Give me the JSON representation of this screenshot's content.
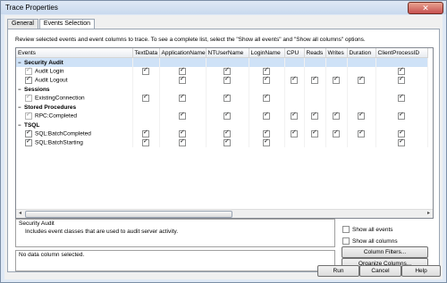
{
  "window": {
    "title": "Trace Properties",
    "close_glyph": "✕"
  },
  "tabs": [
    {
      "label": "General"
    },
    {
      "label": "Events Selection"
    }
  ],
  "description": "Review selected events and event columns to trace. To see a complete list, select the \"Show all events\" and \"Show all columns\" options.",
  "grid": {
    "columns": [
      "Events",
      "TextData",
      "ApplicationName",
      "NTUserName",
      "LoginName",
      "CPU",
      "Reads",
      "Writes",
      "Duration",
      "ClientProcessID"
    ],
    "rows": [
      {
        "type": "category",
        "label": "Security Audit",
        "expander": "−",
        "selected": true
      },
      {
        "type": "event",
        "label": "Audit Login",
        "checked": true,
        "disabled": true,
        "cells": [
          true,
          true,
          true,
          true,
          false,
          false,
          false,
          false,
          true
        ]
      },
      {
        "type": "event",
        "label": "Audit Logout",
        "checked": true,
        "disabled": false,
        "cells": [
          false,
          true,
          true,
          true,
          true,
          true,
          true,
          true,
          true
        ]
      },
      {
        "type": "category",
        "label": "Sessions",
        "expander": "−",
        "selected": false
      },
      {
        "type": "event",
        "label": "ExistingConnection",
        "checked": true,
        "disabled": true,
        "cells": [
          true,
          true,
          true,
          true,
          false,
          false,
          false,
          false,
          true
        ]
      },
      {
        "type": "category",
        "label": "Stored Procedures",
        "expander": "−",
        "selected": false
      },
      {
        "type": "event",
        "label": "RPC:Completed",
        "checked": true,
        "disabled": true,
        "cells": [
          false,
          true,
          true,
          true,
          true,
          true,
          true,
          true,
          true
        ]
      },
      {
        "type": "category",
        "label": "TSQL",
        "expander": "−",
        "selected": false
      },
      {
        "type": "event",
        "label": "SQL:BatchCompleted",
        "checked": true,
        "disabled": false,
        "cells": [
          true,
          true,
          true,
          true,
          true,
          true,
          true,
          true,
          true
        ]
      },
      {
        "type": "event",
        "label": "SQL:BatchStarting",
        "checked": true,
        "disabled": false,
        "cells": [
          true,
          true,
          true,
          true,
          false,
          false,
          false,
          false,
          true
        ]
      }
    ]
  },
  "info": {
    "event_title": "Security Audit",
    "event_desc": "Includes event classes that are used to audit server activity.",
    "column_title": "No data column selected."
  },
  "options": {
    "show_all_events": "Show all events",
    "show_all_columns": "Show all columns"
  },
  "buttons": {
    "column_filters": "Column Filters...",
    "organize_columns": "Organize Columns...",
    "run": "Run",
    "cancel": "Cancel",
    "help": "Help"
  },
  "icons": {
    "scroll_left": "◂",
    "scroll_right": "▸"
  }
}
